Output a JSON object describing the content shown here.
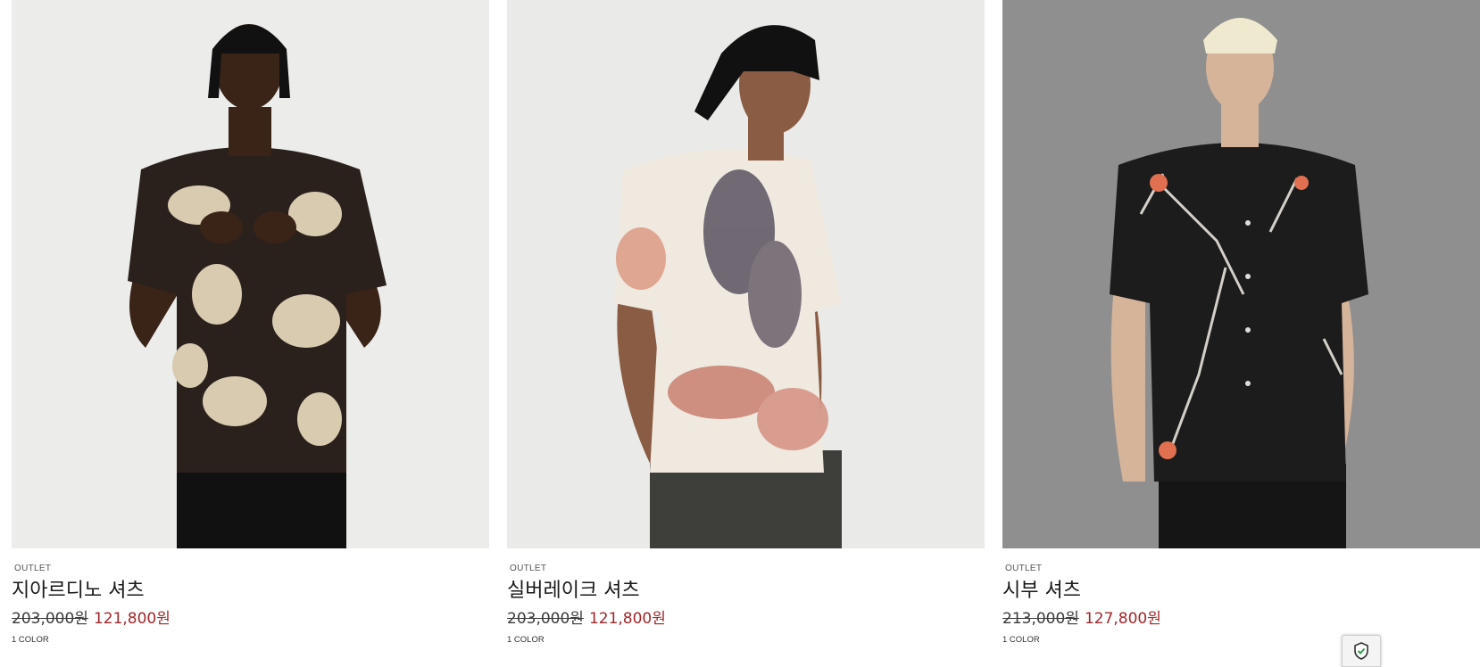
{
  "products": [
    {
      "badge": "OUTLET",
      "name": "지아르디노 셔츠",
      "original_price": "203,000원",
      "sale_price": "121,800원",
      "colors": "1 COLOR",
      "image": "model-floral-beige-black-shirt"
    },
    {
      "badge": "OUTLET",
      "name": "실버레이크 셔츠",
      "original_price": "203,000원",
      "sale_price": "121,800원",
      "colors": "1 COLOR",
      "image": "model-ivory-watercolor-shirt"
    },
    {
      "badge": "OUTLET",
      "name": "시부 셔츠",
      "original_price": "213,000원",
      "sale_price": "127,800원",
      "colors": "1 COLOR",
      "image": "model-black-floral-shirt"
    }
  ],
  "colors": {
    "sale_price": "#a3262a",
    "text": "#1a1a1a",
    "photo_bg_light": "#ececea",
    "photo_bg_grey": "#8f8f8f"
  },
  "widgets": {
    "security_icon": "shield-check-icon"
  }
}
